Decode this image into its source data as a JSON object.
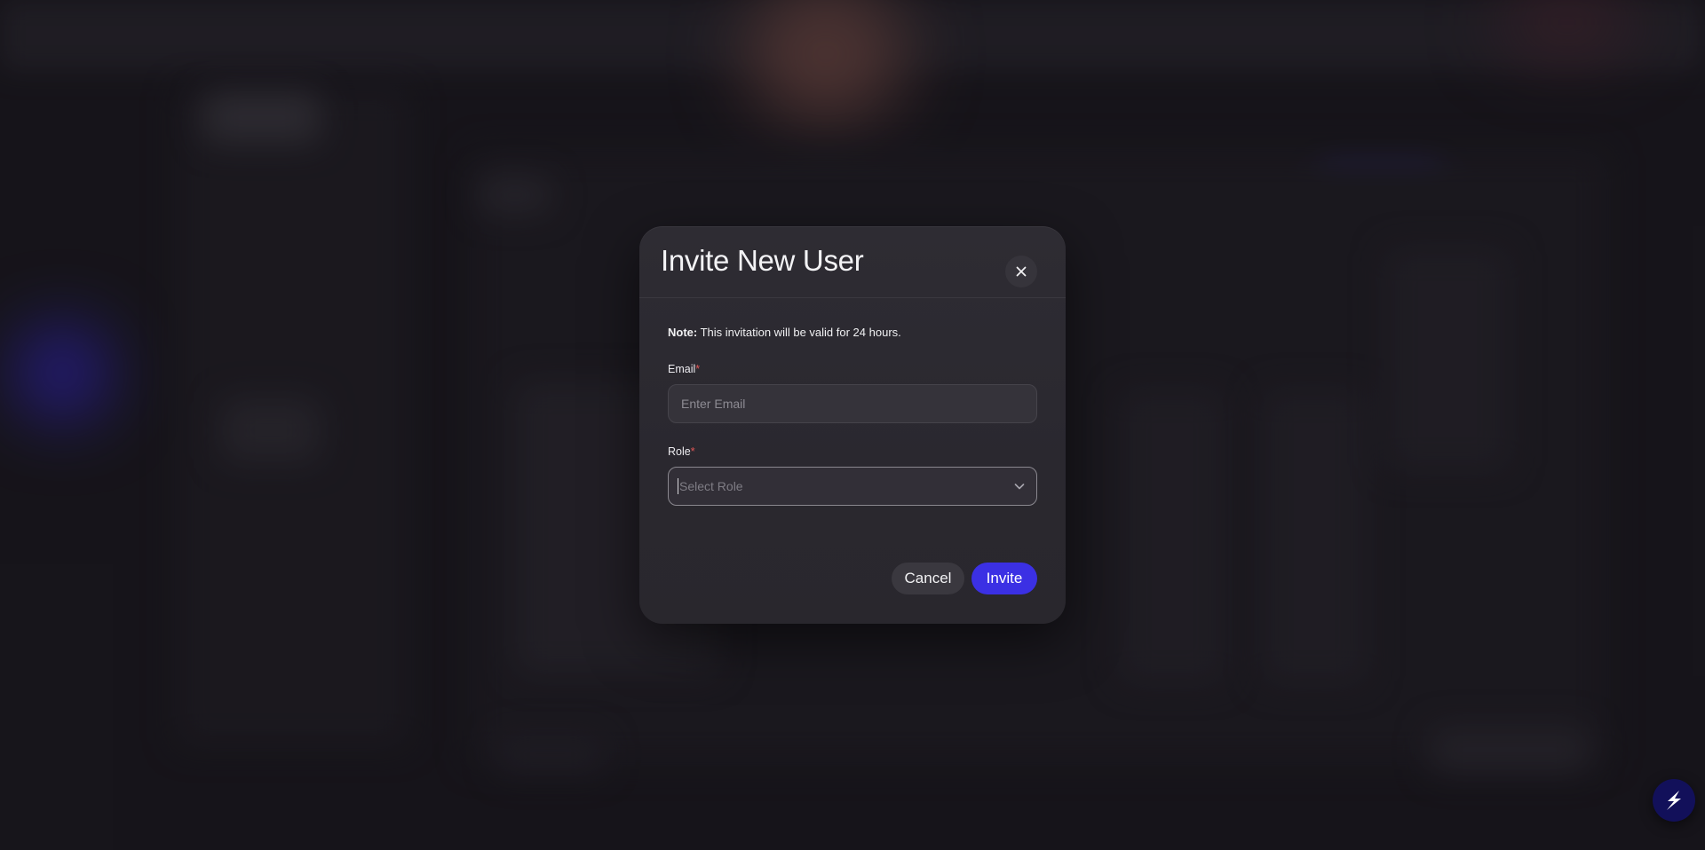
{
  "modal": {
    "title": "Invite New User",
    "close_icon": "close-icon",
    "note_label": "Note:",
    "note_text": " This invitation will be valid for 24 hours.",
    "email": {
      "label": "Email",
      "required_mark": "*",
      "placeholder": "Enter Email",
      "value": ""
    },
    "role": {
      "label": "Role",
      "required_mark": "*",
      "placeholder": "Select Role",
      "icon": "chevron-down-icon"
    },
    "cancel_label": "Cancel",
    "invite_label": "Invite"
  },
  "fab": {
    "icon": "bolt-logo-icon"
  },
  "colors": {
    "accent": "#3b30e4",
    "required": "#e05656",
    "modal_bg": "#2e2c33",
    "backdrop": "#18161c"
  }
}
